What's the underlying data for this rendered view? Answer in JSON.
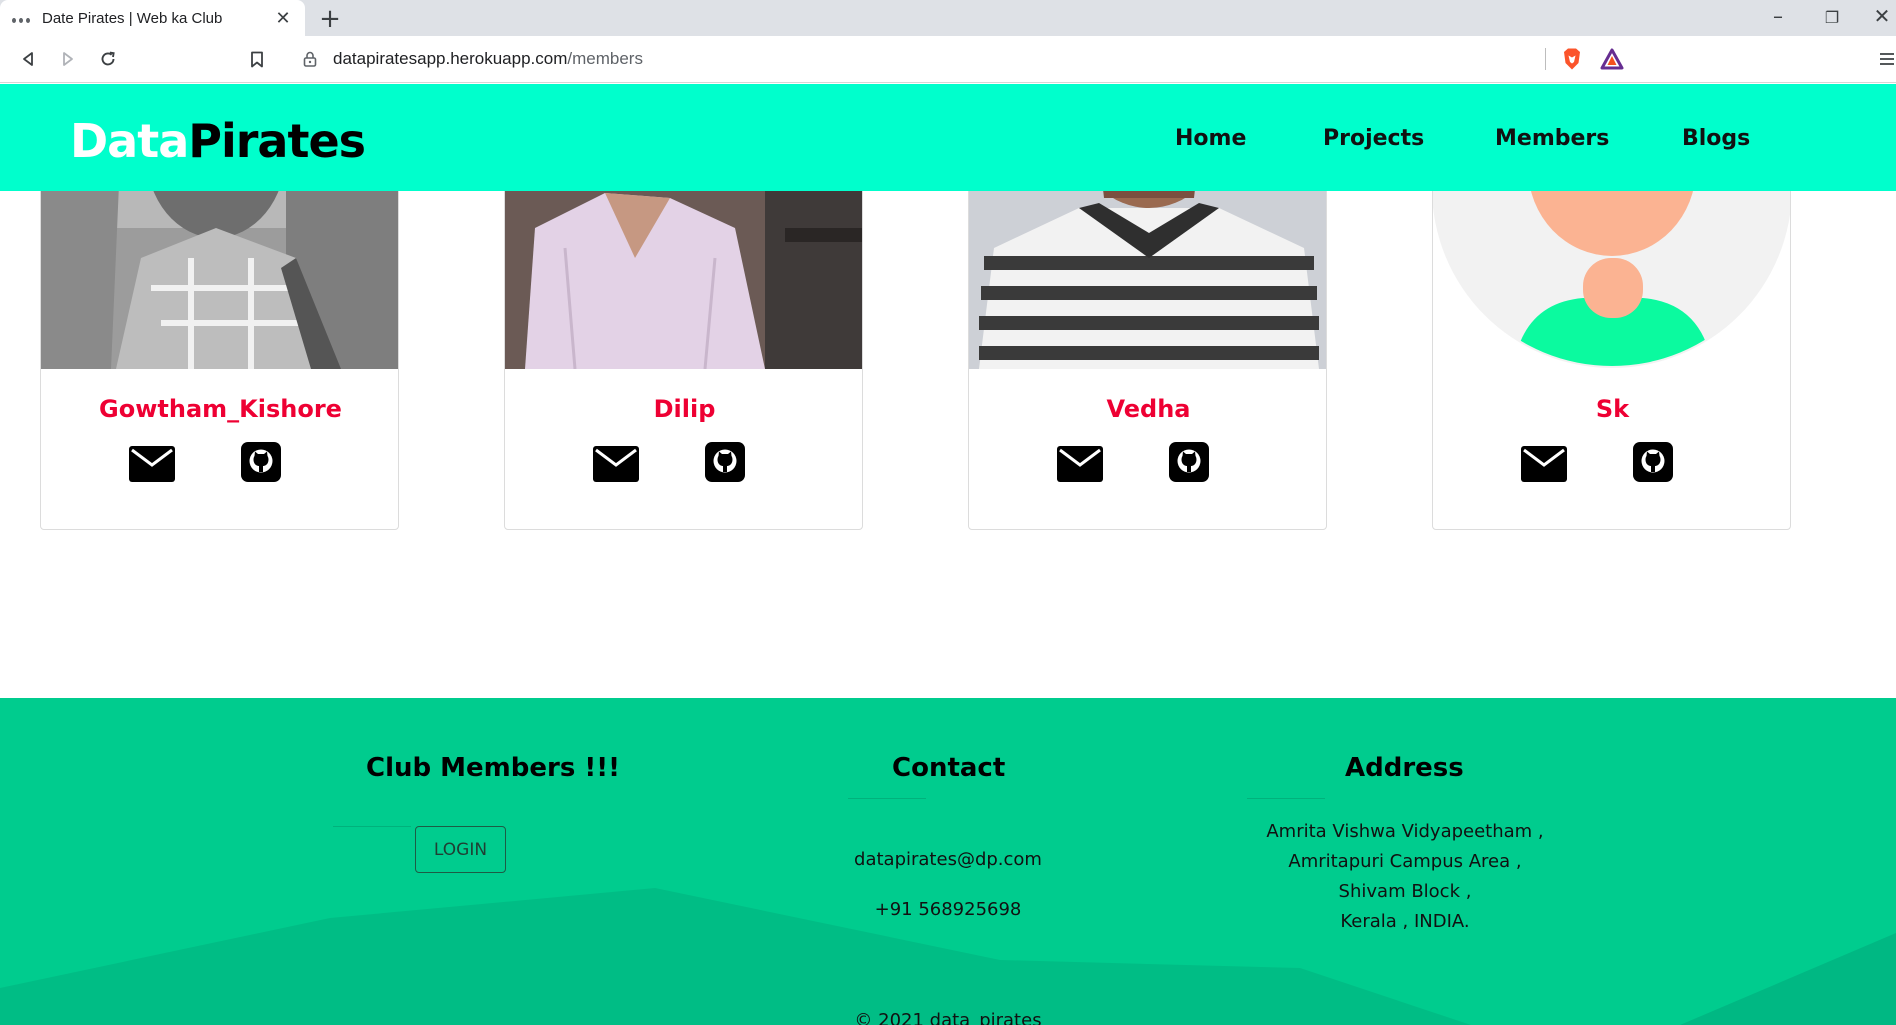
{
  "browser": {
    "tab_title": "Date Pirates | Web ka Club",
    "url_host": "datapiratesapp.herokuapp.com",
    "url_path": "/members"
  },
  "site": {
    "logo_part1": "Data",
    "logo_part2": "Pirates",
    "nav": [
      "Home",
      "Projects",
      "Members",
      "Blogs"
    ],
    "colors": {
      "nav_bg": "#00ffcc",
      "name": "#ee0033",
      "footer_bg": "#00cc8e"
    }
  },
  "members": [
    {
      "name": "Gowtham_Kishore",
      "icons": [
        "mail-icon",
        "github-icon"
      ]
    },
    {
      "name": "Dilip",
      "icons": [
        "mail-icon",
        "github-icon"
      ]
    },
    {
      "name": "Vedha",
      "icons": [
        "mail-icon",
        "github-icon"
      ]
    },
    {
      "name": "Sk",
      "icons": [
        "mail-icon",
        "github-icon"
      ]
    }
  ],
  "footer": {
    "club_heading": "Club Members !!!",
    "login_label": "LOGIN",
    "contact_heading": "Contact",
    "email": "datapirates@dp.com",
    "phone": "+91 568925698",
    "address_heading": "Address",
    "address_lines": [
      "Amrita Vishwa Vidyapeetham ,",
      "Amritapuri Campus Area ,",
      "Shivam Block ,",
      "Kerala , INDIA."
    ],
    "copyright": "© 2021 data_pirates"
  }
}
